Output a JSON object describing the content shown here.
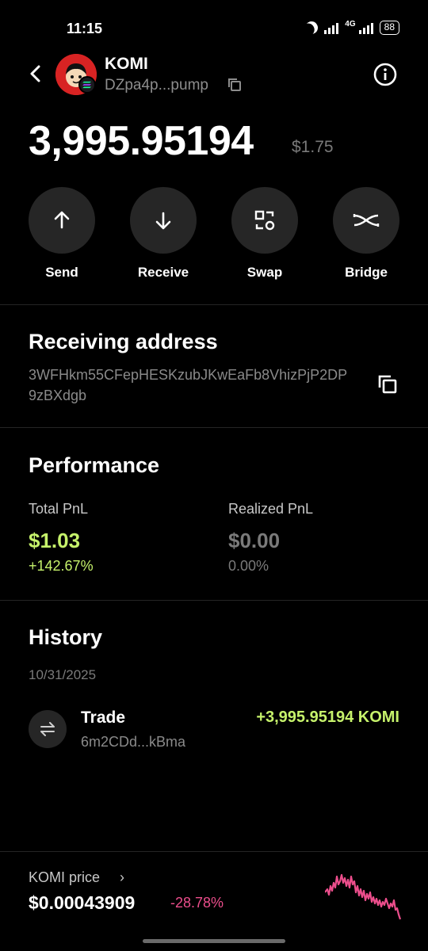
{
  "status_bar": {
    "time": "11:15",
    "network": "4G",
    "battery": "88"
  },
  "header": {
    "token_name": "KOMI",
    "token_address": "DZpa4p...pump"
  },
  "balance": {
    "amount": "3,995.95194",
    "usd": "$1.75"
  },
  "actions": [
    {
      "label": "Send",
      "icon": "arrow-up-icon"
    },
    {
      "label": "Receive",
      "icon": "arrow-down-icon"
    },
    {
      "label": "Swap",
      "icon": "swap-icon"
    },
    {
      "label": "Bridge",
      "icon": "bridge-icon"
    }
  ],
  "receiving": {
    "title": "Receiving address",
    "address": "3WFHkm55CFepHESKzubJKwEaFb8VhizPjP2DP9zBXdgb"
  },
  "performance": {
    "title": "Performance",
    "total_label": "Total PnL",
    "total_value": "$1.03",
    "total_pct": "+142.67%",
    "realized_label": "Realized PnL",
    "realized_value": "$0.00",
    "realized_pct": "0.00%"
  },
  "history": {
    "title": "History",
    "date": "10/31/2025",
    "items": [
      {
        "type": "Trade",
        "counterparty": "6m2CDd...kBma",
        "amount": "+3,995.95194 KOMI"
      }
    ]
  },
  "price": {
    "label": "KOMI price",
    "value": "$0.00043909",
    "change": "-28.78%"
  },
  "colors": {
    "positive": "#c6f26b",
    "negative": "#ec4e8c",
    "muted": "#8a8a8a",
    "button_bg": "#262626"
  }
}
